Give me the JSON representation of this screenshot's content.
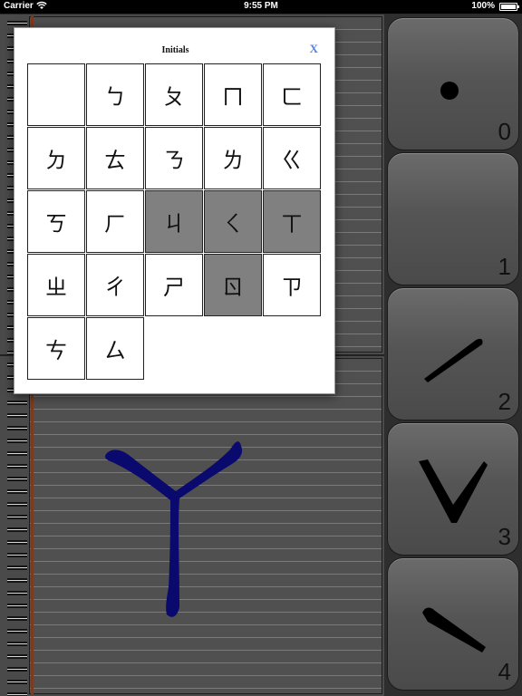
{
  "status_bar": {
    "carrier": "Carrier",
    "time": "9:55 PM",
    "battery": "100%",
    "battery_level": 1.0
  },
  "popover": {
    "title": "Initials",
    "close_label": "X",
    "cells": [
      {
        "symbol": "",
        "dim": false
      },
      {
        "symbol": "ㄅ",
        "dim": false
      },
      {
        "symbol": "ㄆ",
        "dim": false
      },
      {
        "symbol": "ㄇ",
        "dim": false
      },
      {
        "symbol": "ㄈ",
        "dim": false
      },
      {
        "symbol": "ㄉ",
        "dim": false
      },
      {
        "symbol": "ㄊ",
        "dim": false
      },
      {
        "symbol": "ㄋ",
        "dim": false
      },
      {
        "symbol": "ㄌ",
        "dim": false
      },
      {
        "symbol": "ㄍ",
        "dim": false
      },
      {
        "symbol": "ㄎ",
        "dim": false
      },
      {
        "symbol": "ㄏ",
        "dim": false
      },
      {
        "symbol": "ㄐ",
        "dim": true
      },
      {
        "symbol": "ㄑ",
        "dim": true
      },
      {
        "symbol": "ㄒ",
        "dim": true
      },
      {
        "symbol": "ㄓ",
        "dim": false
      },
      {
        "symbol": "ㄔ",
        "dim": false
      },
      {
        "symbol": "ㄕ",
        "dim": false
      },
      {
        "symbol": "ㄖ",
        "dim": true
      },
      {
        "symbol": "ㄗ",
        "dim": false
      },
      {
        "symbol": "ㄘ",
        "dim": false
      },
      {
        "symbol": "ㄙ",
        "dim": false
      }
    ]
  },
  "canvas": {
    "glyph_color": "#0a0a6e"
  },
  "stroke_buttons": [
    {
      "number": "0",
      "stroke": "dot"
    },
    {
      "number": "1",
      "stroke": "none"
    },
    {
      "number": "2",
      "stroke": "rising"
    },
    {
      "number": "3",
      "stroke": "v-shape"
    },
    {
      "number": "4",
      "stroke": "falling"
    }
  ]
}
